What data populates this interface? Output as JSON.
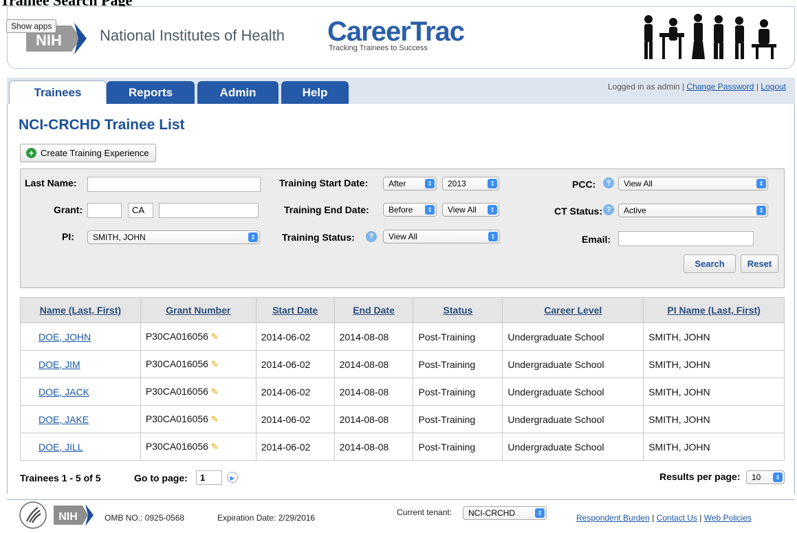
{
  "top_heading": "Trainee Search Page",
  "header": {
    "show_apps": "Show apps",
    "nih_logo_text": "NIH",
    "nih_name": "National Institutes of Health",
    "app_name": "CareerTrac",
    "tagline": "Tracking Trainees to Success"
  },
  "tabs": [
    {
      "label": "Trainees",
      "active": true
    },
    {
      "label": "Reports",
      "active": false
    },
    {
      "label": "Admin",
      "active": false
    },
    {
      "label": "Help",
      "active": false
    }
  ],
  "login": {
    "prefix": "Logged in as admin",
    "separator": "|",
    "change_password": "Change Password",
    "logout": "Logout"
  },
  "page_title": "NCI-CRCHD Trainee List",
  "create_button": "Create Training Experience",
  "filters": {
    "last_name_label": "Last Name:",
    "last_name_value": "",
    "grant_label": "Grant:",
    "grant_part1": "",
    "grant_part2": "CA",
    "grant_part3": "",
    "pi_label": "PI:",
    "pi_value": "SMITH, JOHN",
    "start_date_label": "Training Start Date:",
    "start_date_op": "After",
    "start_date_year": "2013",
    "end_date_label": "Training End Date:",
    "end_date_op": "Before",
    "end_date_year": "View All",
    "status_label": "Training Status:",
    "status_value": "View All",
    "pcc_label": "PCC:",
    "pcc_value": "View All",
    "ct_status_label": "CT Status:",
    "ct_status_value": "Active",
    "email_label": "Email:",
    "email_value": "",
    "search_button": "Search",
    "reset_button": "Reset"
  },
  "table": {
    "headers": [
      "Name (Last, First)",
      "Grant Number",
      "Start Date",
      "End Date",
      "Status",
      "Career Level",
      "PI Name (Last, First)"
    ],
    "rows": [
      {
        "name": "DOE, JOHN",
        "grant": "P30CA016056",
        "start": "2014-06-02",
        "end": "2014-08-08",
        "status": "Post-Training",
        "career": "Undergraduate School",
        "pi": "SMITH, JOHN"
      },
      {
        "name": "DOE, JIM",
        "grant": "P30CA016056",
        "start": "2014-06-02",
        "end": "2014-08-08",
        "status": "Post-Training",
        "career": "Undergraduate School",
        "pi": "SMITH, JOHN"
      },
      {
        "name": "DOE, JACK",
        "grant": "P30CA016056",
        "start": "2014-06-02",
        "end": "2014-08-08",
        "status": "Post-Training",
        "career": "Undergraduate School",
        "pi": "SMITH, JOHN"
      },
      {
        "name": "DOE, JAKE",
        "grant": "P30CA016056",
        "start": "2014-06-02",
        "end": "2014-08-08",
        "status": "Post-Training",
        "career": "Undergraduate School",
        "pi": "SMITH, JOHN"
      },
      {
        "name": "DOE, JILL",
        "grant": "P30CA016056",
        "start": "2014-06-02",
        "end": "2014-08-08",
        "status": "Post-Training",
        "career": "Undergraduate School",
        "pi": "SMITH, JOHN"
      }
    ]
  },
  "pagination": {
    "summary": "Trainees 1 - 5 of 5",
    "go_to_label": "Go to page:",
    "page_value": "1",
    "results_per_page_label": "Results per page:",
    "results_per_page_value": "10"
  },
  "footer": {
    "nih_text": "NIH",
    "omb": "OMB NO.: 0925-0568",
    "expiration": "Expiration Date: 2/29/2016",
    "tenant_label": "Current tenant:",
    "tenant_value": "NCI-CRCHD",
    "links": [
      "Respondent Burden",
      "Contact Us",
      "Web Policies"
    ],
    "separator": "|"
  }
}
